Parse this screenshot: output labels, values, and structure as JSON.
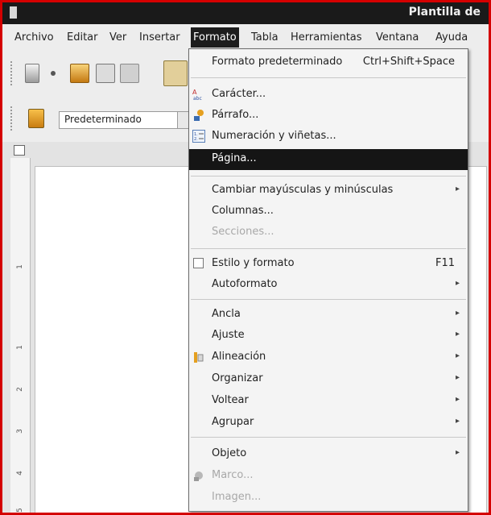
{
  "window": {
    "title": "Plantilla de"
  },
  "menubar": {
    "items": [
      {
        "label": "Archivo"
      },
      {
        "label": "Editar"
      },
      {
        "label": "Ver"
      },
      {
        "label": "Insertar"
      },
      {
        "label": "Formato"
      },
      {
        "label": "Tabla"
      },
      {
        "label": "Herramientas"
      },
      {
        "label": "Ventana"
      },
      {
        "label": "Ayuda"
      }
    ]
  },
  "toolbar": {
    "paragraph_style": "Predeterminado"
  },
  "ruler": {
    "ticks": [
      "1",
      "1",
      "2",
      "3",
      "4",
      "5"
    ]
  },
  "format_menu": {
    "items": [
      {
        "label": "Formato predeterminado",
        "shortcut": "Ctrl+Shift+Space"
      },
      {
        "label": "Carácter..."
      },
      {
        "label": "Párrafo..."
      },
      {
        "label": "Numeración y viñetas..."
      },
      {
        "label": "Página..."
      },
      {
        "label": "Cambiar mayúsculas y minúsculas"
      },
      {
        "label": "Columnas..."
      },
      {
        "label": "Secciones..."
      },
      {
        "label": "Estilo y formato",
        "shortcut": "F11"
      },
      {
        "label": "Autoformato"
      },
      {
        "label": "Ancla"
      },
      {
        "label": "Ajuste"
      },
      {
        "label": "Alineación"
      },
      {
        "label": "Organizar"
      },
      {
        "label": "Voltear"
      },
      {
        "label": "Agrupar"
      },
      {
        "label": "Objeto"
      },
      {
        "label": "Marco..."
      },
      {
        "label": "Imagen..."
      }
    ]
  },
  "colors": {
    "frame_border": "#d40000",
    "menu_highlight": "#151515",
    "titlebar": "#1a1a1a"
  }
}
